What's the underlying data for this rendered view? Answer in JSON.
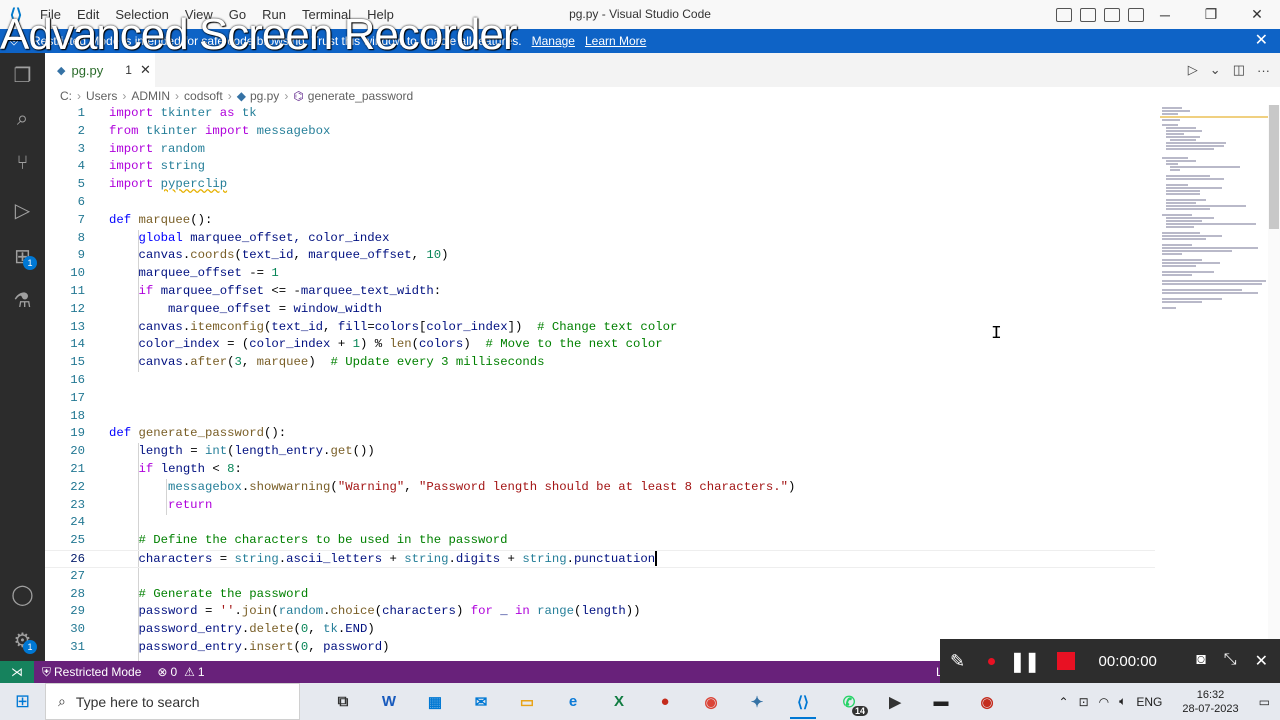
{
  "window": {
    "title": "pg.py - Visual Studio Code",
    "menu": [
      "File",
      "Edit",
      "Selection",
      "View",
      "Go",
      "Run",
      "Terminal",
      "Help"
    ],
    "controls": [
      "─",
      "❐",
      "✕"
    ]
  },
  "watermark": "Advanced Screen Recorder",
  "banner": {
    "text": "Restricted Mode is intended for safe code browsing. Trust this window to enable all features.",
    "manage": "Manage",
    "learn_more": "Learn More"
  },
  "tab": {
    "filename": "pg.py",
    "problems": "1"
  },
  "breadcrumb": [
    "C:",
    "Users",
    "ADMIN",
    "codsoft",
    "pg.py",
    "generate_password"
  ],
  "code_lines": [
    {
      "n": "1"
    },
    {
      "n": "2"
    },
    {
      "n": "3"
    },
    {
      "n": "4"
    },
    {
      "n": "5"
    },
    {
      "n": "6"
    },
    {
      "n": "7"
    },
    {
      "n": "8"
    },
    {
      "n": "9"
    },
    {
      "n": "10"
    },
    {
      "n": "11"
    },
    {
      "n": "12"
    },
    {
      "n": "13"
    },
    {
      "n": "14"
    },
    {
      "n": "15"
    },
    {
      "n": "16"
    },
    {
      "n": "17"
    },
    {
      "n": "18"
    },
    {
      "n": "19"
    },
    {
      "n": "20"
    },
    {
      "n": "21"
    },
    {
      "n": "22"
    },
    {
      "n": "23"
    },
    {
      "n": "24"
    },
    {
      "n": "25"
    },
    {
      "n": "26"
    },
    {
      "n": "27"
    },
    {
      "n": "28"
    },
    {
      "n": "29"
    },
    {
      "n": "30"
    },
    {
      "n": "31"
    }
  ],
  "code": {
    "l1": [
      "import",
      "tkinter",
      "as",
      "tk"
    ],
    "l2": [
      "from",
      "tkinter",
      "import",
      "messagebox"
    ],
    "l3": [
      "import",
      "random"
    ],
    "l4": [
      "import",
      "string"
    ],
    "l5": [
      "import",
      "pyperclip"
    ],
    "l7": [
      "def",
      "marquee",
      "():"
    ],
    "l8": [
      "global",
      "marquee_offset, color_index"
    ],
    "l9": [
      "canvas",
      ".",
      "coords",
      "(",
      "text_id",
      ", ",
      "marquee_offset",
      ", ",
      "10",
      ")"
    ],
    "l10": [
      "marquee_offset",
      " -= ",
      "1"
    ],
    "l11": [
      "if",
      "marquee_offset",
      " <= -",
      "marquee_text_width",
      ":"
    ],
    "l12": [
      "marquee_offset",
      " = ",
      "window_width"
    ],
    "l13": [
      "canvas",
      ".",
      "itemconfig",
      "(",
      "text_id",
      ", ",
      "fill",
      "=",
      "colors",
      "[",
      "color_index",
      "])",
      "# Change text color"
    ],
    "l14": [
      "color_index",
      " = (",
      "color_index",
      " + ",
      "1",
      ") % ",
      "len",
      "(",
      "colors",
      ")",
      "# Move to the next color"
    ],
    "l15": [
      "canvas",
      ".",
      "after",
      "(",
      "3",
      ", ",
      "marquee",
      ")",
      "# Update every 3 milliseconds"
    ],
    "l19": [
      "def",
      "generate_password",
      "():"
    ],
    "l20": [
      "length",
      " = ",
      "int",
      "(",
      "length_entry",
      ".",
      "get",
      "())"
    ],
    "l21": [
      "if",
      "length",
      " < ",
      "8",
      ":"
    ],
    "l22": [
      "messagebox",
      ".",
      "showwarning",
      "(",
      "\"Warning\"",
      ", ",
      "\"Password length should be at least 8 characters.\"",
      ")"
    ],
    "l23": [
      "return"
    ],
    "l25": [
      "# Define the characters to be used in the password"
    ],
    "l26": [
      "characters",
      " = ",
      "string",
      ".",
      "ascii_letters",
      " + ",
      "string",
      ".",
      "digits",
      " + ",
      "string",
      ".",
      "punctuation"
    ],
    "l28": [
      "# Generate the password"
    ],
    "l29": [
      "password",
      " = ",
      "''",
      ".",
      "join",
      "(",
      "random",
      ".",
      "choice",
      "(",
      "characters",
      ") ",
      "for",
      " _ ",
      "in",
      " ",
      "range",
      "(",
      "length",
      "))"
    ],
    "l30": [
      "password_entry",
      ".",
      "delete",
      "(",
      "0",
      ", ",
      "tk",
      ".",
      "END",
      ")"
    ],
    "l31": [
      "password_entry",
      ".",
      "insert",
      "(",
      "0",
      ", ",
      "password",
      ")"
    ]
  },
  "statusbar": {
    "restricted": "Restricted Mode",
    "errors": "0",
    "warnings": "1",
    "right": "L"
  },
  "recorder": {
    "time": "00:00:00"
  },
  "taskbar": {
    "search_placeholder": "Type here to search",
    "lang": "ENG",
    "time": "16:32",
    "date": "28-07-2023",
    "whatsapp_badge": "14"
  },
  "colors": {
    "statusbar": "#68217a",
    "banner": "#0e63c6",
    "activitybar": "#2c2c2c"
  }
}
